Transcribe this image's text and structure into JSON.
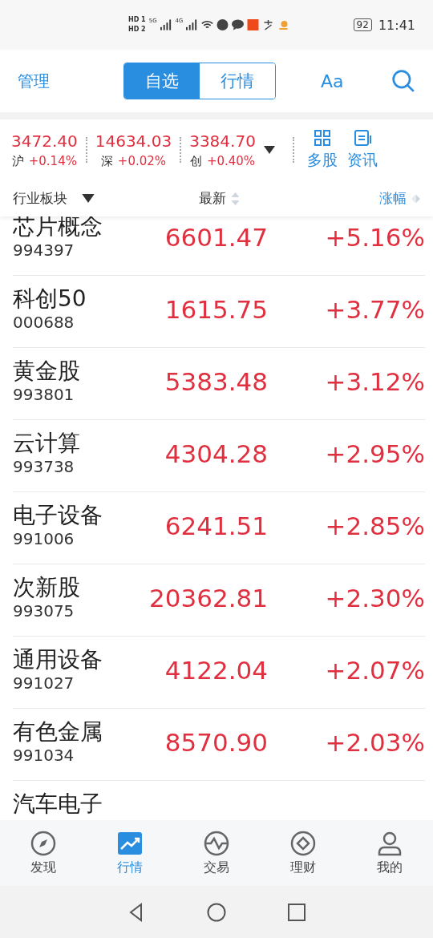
{
  "status_bar": {
    "sim_labels": [
      "HD 1",
      "HD 2"
    ],
    "networks": [
      "5G",
      "4G"
    ],
    "battery": "92",
    "time": "11:41"
  },
  "header": {
    "left": "管理",
    "tabs": [
      {
        "label": "自选",
        "selected": true
      },
      {
        "label": "行情",
        "selected": false
      }
    ],
    "font_button": "Aa"
  },
  "indices": [
    {
      "value": "3472.40",
      "market": "沪",
      "change": "+0.14%"
    },
    {
      "value": "14634.03",
      "market": "深",
      "change": "+0.02%"
    },
    {
      "value": "3384.70",
      "market": "创",
      "change": "+0.40%"
    }
  ],
  "shortcuts": [
    {
      "kind": "grid",
      "label": "多股"
    },
    {
      "kind": "news",
      "label": "资讯"
    }
  ],
  "columns": {
    "category": "行业板块",
    "latest": "最新",
    "change": "涨幅"
  },
  "rows": [
    {
      "name": "芯片概念",
      "code": "994397",
      "price": "6601.47",
      "change": "+5.16%"
    },
    {
      "name": "科创50",
      "code": "000688",
      "price": "1615.75",
      "change": "+3.77%"
    },
    {
      "name": "黄金股",
      "code": "993801",
      "price": "5383.48",
      "change": "+3.12%"
    },
    {
      "name": "云计算",
      "code": "993738",
      "price": "4304.28",
      "change": "+2.95%"
    },
    {
      "name": "电子设备",
      "code": "991006",
      "price": "6241.51",
      "change": "+2.85%"
    },
    {
      "name": "次新股",
      "code": "993075",
      "price": "20362.81",
      "change": "+2.30%"
    },
    {
      "name": "通用设备",
      "code": "991027",
      "price": "4122.04",
      "change": "+2.07%"
    },
    {
      "name": "有色金属",
      "code": "991034",
      "price": "8570.90",
      "change": "+2.03%"
    },
    {
      "name": "汽车电子"
    }
  ],
  "tabbar": [
    {
      "kind": "compass",
      "label": "发现",
      "selected": false
    },
    {
      "kind": "chart",
      "label": "行情",
      "selected": true
    },
    {
      "kind": "wave",
      "label": "交易",
      "selected": false
    },
    {
      "kind": "diamond",
      "label": "理财",
      "selected": false
    },
    {
      "kind": "person",
      "label": "我的",
      "selected": false
    }
  ]
}
